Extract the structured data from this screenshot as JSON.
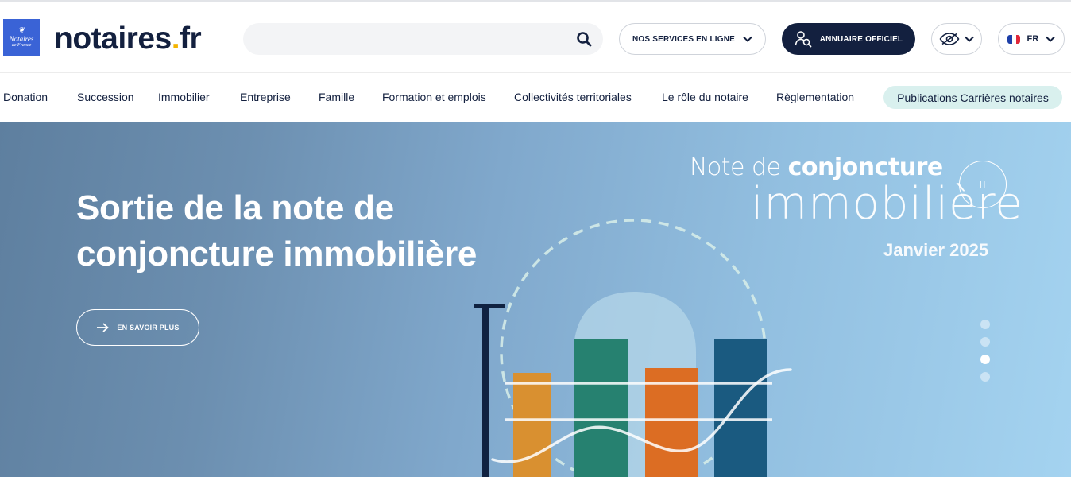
{
  "header": {
    "logo_badge": {
      "line1": "Notaires",
      "line2": "de France"
    },
    "wordmark": {
      "part1": "notaires",
      "dot": ".",
      "part2": "fr"
    },
    "search": {
      "placeholder": "",
      "value": "",
      "icon": "search-icon"
    },
    "services_label": "NOS SERVICES EN LIGNE",
    "annuaire_label": "ANNUAIRE OFFICIEL",
    "accessibility_icon": "eye-icon",
    "language_label": "FR"
  },
  "nav": {
    "items": [
      {
        "label": "Donation"
      },
      {
        "label": "Succession"
      },
      {
        "label": "Immobilier"
      },
      {
        "label": "Entreprise"
      },
      {
        "label": "Famille"
      },
      {
        "label": "Formation et emplois"
      },
      {
        "label": "Collectivités territoriales"
      },
      {
        "label": "Le rôle du notaire"
      },
      {
        "label": "Règlementation"
      }
    ],
    "highlight_label": "Publications Carrières notaires"
  },
  "hero": {
    "title": "Sortie de la note de conjoncture immobilière",
    "cta_label": "EN SAVOIR PLUS",
    "artwork": {
      "line1_light": "Note de",
      "line1_bold": "conjoncture",
      "line2": "immobilière",
      "date": "Janvier 2025"
    },
    "pause_label": "II",
    "slides_total": 4,
    "active_slide": 3
  },
  "colors": {
    "navy": "#13203f",
    "accent_yellow": "#f4b400",
    "logo_blue": "#3a63d6",
    "highlight_teal": "#d9f0ee",
    "bar_orange": "#d99030",
    "bar_green": "#268170",
    "bar_red_orange": "#dc6d23",
    "bar_blue": "#1a5a80"
  }
}
